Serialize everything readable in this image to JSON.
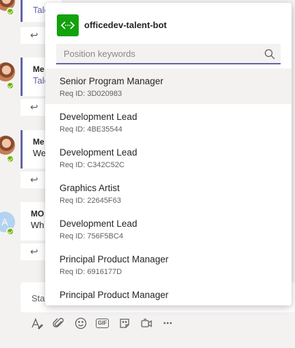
{
  "background_chat": {
    "messages": [
      {
        "sender": "",
        "snippet": "Tale"
      },
      {
        "sender": "Me",
        "snippet": "Tale"
      },
      {
        "sender": "Me",
        "snippet": "We"
      },
      {
        "sender": "MO",
        "snippet": "Wh",
        "avatar_initial": "A"
      }
    ],
    "compose_placeholder": "Sta"
  },
  "bot": {
    "name": "officedev-talent-bot",
    "search": {
      "placeholder": "Position keywords",
      "value": ""
    },
    "results": [
      {
        "title": "Senior Program Manager",
        "req_id": "Req ID: 3D020983"
      },
      {
        "title": "Development Lead",
        "req_id": "Req ID: 4BE35544"
      },
      {
        "title": "Development Lead",
        "req_id": "Req ID: C342C52C"
      },
      {
        "title": "Graphics Artist",
        "req_id": "Req ID: 22645F63"
      },
      {
        "title": "Development Lead",
        "req_id": "Req ID: 756F5BC4"
      },
      {
        "title": "Principal Product Manager",
        "req_id": "Req ID: 6916177D"
      },
      {
        "title": "Principal Product Manager",
        "req_id": ""
      }
    ]
  },
  "toolbar": {
    "icons": [
      "format-icon",
      "attach-icon",
      "emoji-icon",
      "gif-icon",
      "sticker-icon",
      "meet-now-icon",
      "more-options-icon"
    ],
    "gif_label": "GIF",
    "more_label": "•••"
  },
  "colors": {
    "accent": "#6264a7",
    "bot_icon": "#13a10e",
    "presence": "#6bb700"
  }
}
